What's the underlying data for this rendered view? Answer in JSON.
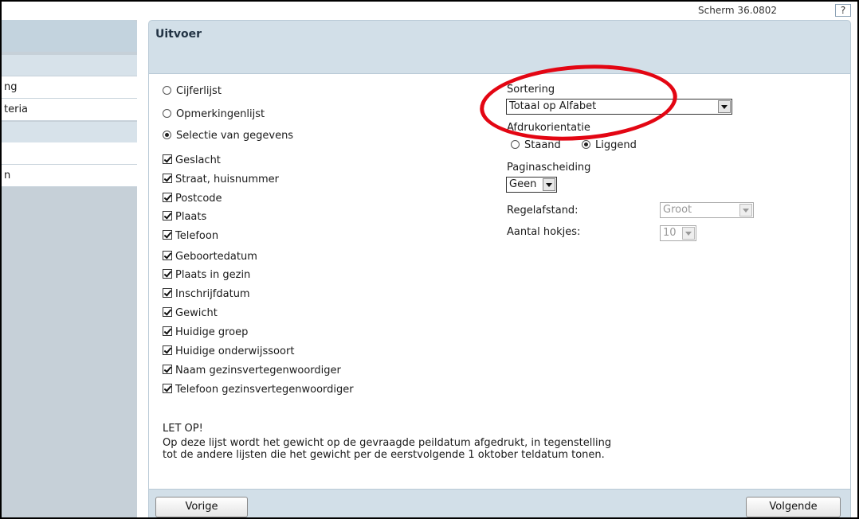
{
  "topbar": {
    "screen_code": "Scherm 36.0802",
    "help_label": "?"
  },
  "sidebar": {
    "items": [
      {
        "label": "ng"
      },
      {
        "label": "teria"
      },
      {
        "label": ""
      },
      {
        "label": "n"
      }
    ]
  },
  "panel": {
    "title": "Uitvoer"
  },
  "report_type": {
    "options": [
      {
        "label": "Cijferlijst",
        "checked": false
      },
      {
        "label": "Opmerkingenlijst",
        "checked": false
      },
      {
        "label": "Selectie van gegevens",
        "checked": true
      }
    ]
  },
  "fields": [
    {
      "label": "Geslacht",
      "checked": true
    },
    {
      "label": "Straat, huisnummer",
      "checked": true
    },
    {
      "label": "Postcode",
      "checked": true
    },
    {
      "label": "Plaats",
      "checked": true
    },
    {
      "label": "Telefoon",
      "checked": true
    },
    {
      "label": "Geboortedatum",
      "checked": true
    },
    {
      "label": "Plaats in gezin",
      "checked": true
    },
    {
      "label": "Inschrijfdatum",
      "checked": true
    },
    {
      "label": "Gewicht",
      "checked": true
    },
    {
      "label": "Huidige groep",
      "checked": true
    },
    {
      "label": "Huidige onderwijssoort",
      "checked": true
    },
    {
      "label": "Naam gezinsvertegenwoordiger",
      "checked": true
    },
    {
      "label": "Telefoon gezinsvertegenwoordiger",
      "checked": true
    }
  ],
  "settings": {
    "sortering_label": "Sortering",
    "sortering_value": "Totaal op Alfabet",
    "orientation_label": "Afdrukorientatie",
    "orientation_options": [
      {
        "label": "Staand",
        "checked": false
      },
      {
        "label": "Liggend",
        "checked": true
      }
    ],
    "paginascheiding_label": "Paginascheiding",
    "paginascheiding_value": "Geen",
    "regelafstand_label": "Regelafstand:",
    "regelafstand_value": "Groot",
    "aantal_hokjes_label": "Aantal hokjes:",
    "aantal_hokjes_value": "10"
  },
  "notice": {
    "title": "LET OP!",
    "line1": "Op deze lijst wordt het gewicht op de gevraagde peildatum afgedrukt, in tegenstelling",
    "line2": "tot de andere lijsten die het gewicht per de eerstvolgende 1 oktober teldatum tonen."
  },
  "footer": {
    "prev_label": "Vorige",
    "next_label": "Volgende"
  },
  "annotation": {
    "shape": "ellipse",
    "color": "#e30613"
  }
}
